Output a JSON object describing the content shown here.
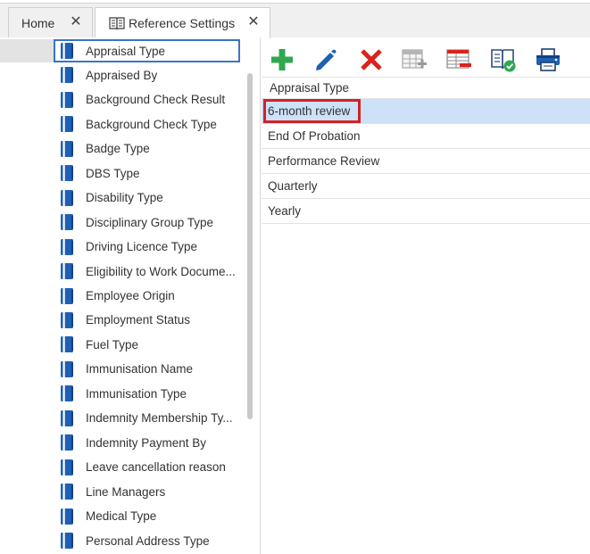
{
  "tabs": [
    {
      "label": "Home",
      "close": "✕"
    },
    {
      "label": "Reference Settings",
      "close": "✕"
    }
  ],
  "sidebar": {
    "items": [
      {
        "label": "Appraisal Type"
      },
      {
        "label": "Appraised By"
      },
      {
        "label": "Background Check Result"
      },
      {
        "label": "Background Check Type"
      },
      {
        "label": "Badge Type"
      },
      {
        "label": "DBS Type"
      },
      {
        "label": "Disability Type"
      },
      {
        "label": "Disciplinary Group Type"
      },
      {
        "label": "Driving Licence Type"
      },
      {
        "label": "Eligibility to Work Docume..."
      },
      {
        "label": "Employee Origin"
      },
      {
        "label": "Employment Status"
      },
      {
        "label": "Fuel Type"
      },
      {
        "label": "Immunisation Name"
      },
      {
        "label": "Immunisation Type"
      },
      {
        "label": "Indemnity Membership Ty..."
      },
      {
        "label": "Indemnity Payment By"
      },
      {
        "label": "Leave cancellation reason"
      },
      {
        "label": "Line Managers"
      },
      {
        "label": "Medical Type"
      },
      {
        "label": "Personal Address Type"
      }
    ],
    "selected_item": "Appraisal Type"
  },
  "toolbar": {
    "buttons": [
      {
        "icon": "plus-icon"
      },
      {
        "icon": "pencil-icon"
      },
      {
        "icon": "delete-x-icon"
      },
      {
        "icon": "add-row-icon"
      },
      {
        "icon": "remove-row-icon"
      },
      {
        "icon": "book-check-icon"
      },
      {
        "icon": "printer-icon"
      }
    ]
  },
  "grid": {
    "header": "Appraisal Type",
    "rows": [
      {
        "value": "6-month review"
      },
      {
        "value": "End Of Probation"
      },
      {
        "value": "Performance Review"
      },
      {
        "value": "Quarterly"
      },
      {
        "value": "Yearly"
      }
    ],
    "selected_row": "6-month review"
  },
  "colors": {
    "accent": "#3b73c9",
    "selection_row": "#cde1f7",
    "highlight_box": "#d42027",
    "add": "#2fa84f",
    "delete": "#d9241c",
    "icon_blue": "#1f5fb5"
  }
}
